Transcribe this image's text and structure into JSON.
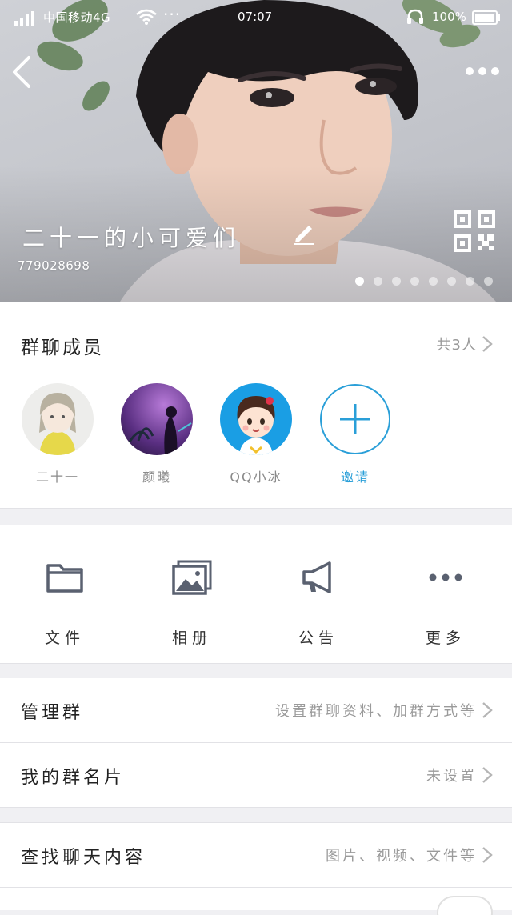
{
  "status_bar": {
    "carrier": "中国移动4G",
    "more": "···",
    "time": "07:07",
    "battery": "100%"
  },
  "group": {
    "name": "二十一的小可爱们",
    "id": "779028698",
    "photo_pages": 8,
    "current_photo_page": 1
  },
  "members": {
    "title": "群聊成员",
    "count": "共3人",
    "items": [
      {
        "name": "二十一",
        "avatar": "girl-cartoon-avatar"
      },
      {
        "name": "颜曦",
        "avatar": "purple-night-avatar"
      },
      {
        "name": "QQ小冰",
        "avatar": "cartoon-girl-blue-avatar"
      }
    ],
    "invite_label": "邀请"
  },
  "tools": {
    "file": "文件",
    "album": "相册",
    "notice": "公告",
    "more": "更多"
  },
  "rows": {
    "manage": {
      "label": "管理群",
      "value": "设置群聊资料、加群方式等"
    },
    "card": {
      "label": "我的群名片",
      "value": "未设置"
    },
    "search": {
      "label": "查找聊天内容",
      "value": "图片、视频、文件等"
    }
  },
  "colors": {
    "accent": "#2a9fd8",
    "icon_gray": "#5a6170",
    "secondary_text": "#9a9a9a"
  }
}
